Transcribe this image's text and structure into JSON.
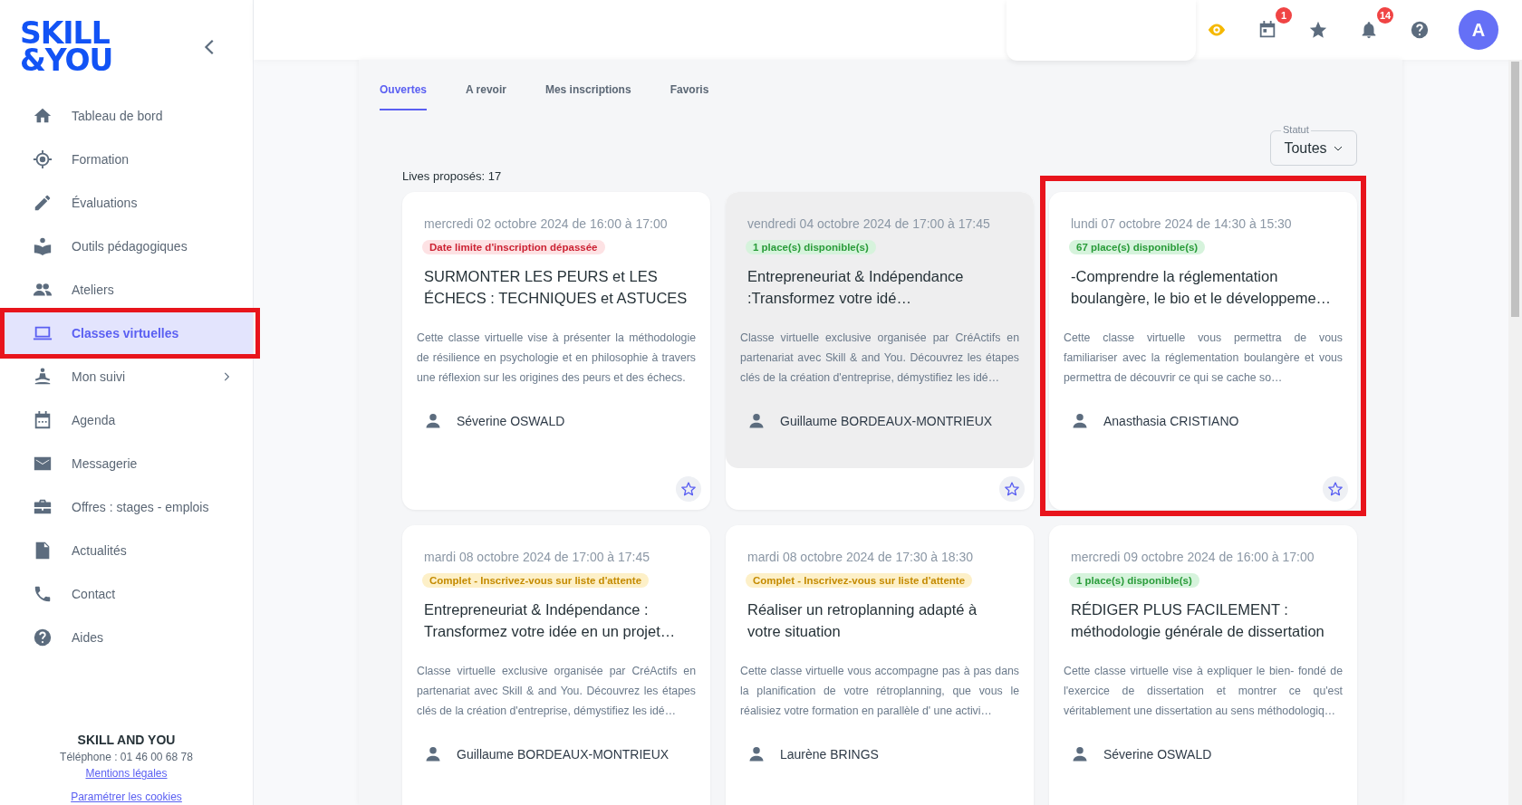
{
  "sidebar": {
    "logo": [
      "SKILL",
      "&YOU"
    ],
    "items": [
      {
        "label": "Tableau de bord",
        "selected": false
      },
      {
        "label": "Formation",
        "selected": false
      },
      {
        "label": "Évaluations",
        "selected": false
      },
      {
        "label": "Outils pédagogiques",
        "selected": false
      },
      {
        "label": "Ateliers",
        "selected": false
      },
      {
        "label": "Classes virtuelles",
        "selected": true,
        "highlighted": true
      },
      {
        "label": "Mon suivi",
        "selected": false,
        "has_submenu": true
      },
      {
        "label": "Agenda",
        "selected": false
      },
      {
        "label": "Messagerie",
        "selected": false
      },
      {
        "label": "Offres : stages - emplois",
        "selected": false
      },
      {
        "label": "Actualités",
        "selected": false
      },
      {
        "label": "Contact",
        "selected": false
      },
      {
        "label": "Aides",
        "selected": false
      }
    ],
    "footer": {
      "company": "SKILL AND YOU",
      "phone": "Téléphone : 01 46 00 68 78",
      "links": [
        "Mentions légales",
        "Paramétrer les cookies"
      ]
    }
  },
  "header": {
    "calendar_badge": "1",
    "notification_badge": "14",
    "avatar": "A"
  },
  "tabs": [
    {
      "label": "Ouvertes",
      "selected": true
    },
    {
      "label": "A revoir",
      "selected": false
    },
    {
      "label": "Mes inscriptions",
      "selected": false
    },
    {
      "label": "Favoris",
      "selected": false
    }
  ],
  "filter": {
    "label": "Statut",
    "value": "Toutes"
  },
  "count": "Lives proposés: 17",
  "cards": [
    {
      "date": "mercredi 02 octobre 2024 de 16:00 à 17:00",
      "status": {
        "kind": "expired",
        "text": "Date limite d'inscription dépassée"
      },
      "title": "SURMONTER LES PEURS et LES ÉCHECS : TECHNIQUES et ASTUCES",
      "description": "Cette classe virtuelle vise à présenter la méthodologie de résilience en psychologie et en philosophie à travers une réflexion sur les origines des peurs et des échecs.",
      "presenter": "Séverine OSWALD",
      "favorite": false,
      "hovered": false,
      "highlighted": false
    },
    {
      "date": "vendredi 04 octobre 2024 de 17:00 à 17:45",
      "status": {
        "kind": "available",
        "text": "1 place(s) disponible(s)"
      },
      "title": "Entrepreneuriat & Indépendance :Transformez votre idé…",
      "description": "Classe virtuelle exclusive organisée par CréActifs en partenariat avec Skill & and You. Découvrez les étapes clés de la création d'entreprise, démystifiez les idé…",
      "presenter": "Guillaume BORDEAUX-MONTRIEUX",
      "favorite": false,
      "hovered": true,
      "highlighted": false
    },
    {
      "date": "lundi 07 octobre 2024 de 14:30 à 15:30",
      "status": {
        "kind": "available",
        "text": "67 place(s) disponible(s)"
      },
      "title": "-Comprendre la réglementation boulangère, le bio et le développeme…",
      "description": "Cette classe virtuelle vous permettra de vous familiariser avec la réglementation boulangère et vous permettra de découvrir ce qui se cache so…",
      "presenter": "Anasthasia CRISTIANO",
      "favorite": false,
      "hovered": false,
      "highlighted": true
    },
    {
      "date": "mardi 08 octobre 2024 de 17:00 à 17:45",
      "status": {
        "kind": "full",
        "text": "Complet - Inscrivez-vous sur liste d'attente"
      },
      "title": "Entrepreneuriat & Indépendance : Transformez votre idée en un projet…",
      "description": "Classe virtuelle exclusive organisée par CréActifs en partenariat avec Skill & and You. Découvrez les étapes clés de la création d'entreprise, démystifiez les idé…",
      "presenter": "Guillaume BORDEAUX-MONTRIEUX",
      "hovered": false,
      "highlighted": false
    },
    {
      "date": "mardi 08 octobre 2024 de 17:30 à 18:30",
      "status": {
        "kind": "full",
        "text": "Complet - Inscrivez-vous sur liste d'attente"
      },
      "title": "Réaliser un retroplanning adapté à votre situation",
      "description": "Cette classe virtuelle vous accompagne pas à pas dans la planification de votre rétroplanning, que vous le réalisiez votre formation en parallèle d' une activi…",
      "presenter": "Laurène BRINGS",
      "hovered": false,
      "highlighted": false
    },
    {
      "date": "mercredi 09 octobre 2024 de 16:00 à 17:00",
      "status": {
        "kind": "available",
        "text": "1 place(s) disponible(s)"
      },
      "title": "RÉDIGER PLUS FACILEMENT : méthodologie générale de dissertation",
      "description": "Cette classe virtuelle vise à expliquer le bien- fondé de l'exercice de dissertation et montrer ce qu'est véritablement une dissertation au sens méthodologiq…",
      "presenter": "Séverine OSWALD",
      "hovered": false,
      "highlighted": false
    }
  ]
}
